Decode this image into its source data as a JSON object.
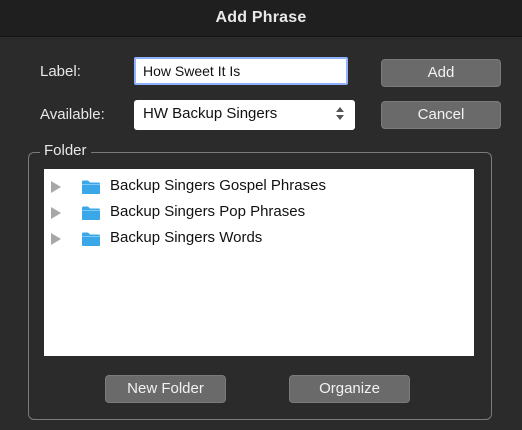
{
  "window": {
    "title": "Add Phrase"
  },
  "form": {
    "label_text": "Label:",
    "label_value": "How Sweet It Is",
    "available_text": "Available:",
    "available_selected": "HW Backup Singers"
  },
  "buttons": {
    "add": "Add",
    "cancel": "Cancel",
    "new_folder": "New Folder",
    "organize": "Organize"
  },
  "folder_group": {
    "legend": "Folder",
    "items": [
      {
        "name": "Backup Singers Gospel Phrases",
        "icon": "folder-icon"
      },
      {
        "name": "Backup Singers Pop Phrases",
        "icon": "folder-icon"
      },
      {
        "name": "Backup Singers Words",
        "icon": "folder-icon"
      }
    ]
  },
  "colors": {
    "background": "#2b2b2b",
    "titlebar": "#1f1f1f",
    "button": "#6a6a6a",
    "folder_blue": "#3aa8e8",
    "focus_ring": "#8fb3ff"
  }
}
